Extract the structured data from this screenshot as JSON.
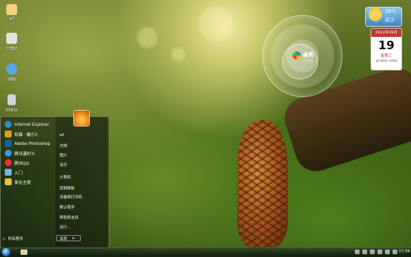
{
  "desktop": {
    "icons": [
      {
        "label": "wf",
        "icon": "folder-icon",
        "color": "#f1d27a"
      },
      {
        "label": "计算机",
        "icon": "computer-icon",
        "color": "#dfe6d8"
      },
      {
        "label": "网络",
        "icon": "network-icon",
        "color": "#5aa6e6"
      },
      {
        "label": "回收站",
        "icon": "recycle-bin-icon",
        "color": "#cfd6d6"
      }
    ]
  },
  "start_menu": {
    "programs": [
      {
        "label": "Internet Explorer",
        "icon": "ie-icon",
        "color": "#2f8ad6"
      },
      {
        "label": "软媒 · 魔方3",
        "icon": "rubik-icon",
        "color": "#e0a21a"
      },
      {
        "label": "Adobe Photoshop",
        "icon": "photoshop-icon",
        "color": "#1a5fb0"
      },
      {
        "label": "腾讯通RTX",
        "icon": "rtx-icon",
        "color": "#3a9be0"
      },
      {
        "label": "腾讯QQ",
        "icon": "qq-icon",
        "color": "#e33"
      },
      {
        "label": "入门",
        "icon": "getting-started-icon",
        "color": "#7ab0e8"
      },
      {
        "label": "美化主题",
        "icon": "theme-icon",
        "color": "#e8c23a"
      }
    ],
    "all_programs": "所有程序",
    "places": [
      "wf",
      "文档",
      "图片",
      "音乐",
      "计算机",
      "控制面板",
      "设备和打印机",
      "默认程序",
      "帮助和支持",
      "运行..."
    ],
    "shutdown": "关机"
  },
  "widget": {
    "brand": "桌秀",
    "brand_sub": "zhuoxiu"
  },
  "weather": {
    "temp": "28℃",
    "city": "武汉"
  },
  "calendar": {
    "month": "2012年09月",
    "day": "19",
    "weekday": "星期三",
    "lunar": "龙(壬辰)年八月初四"
  },
  "taskbar": {
    "time": "17:39"
  }
}
